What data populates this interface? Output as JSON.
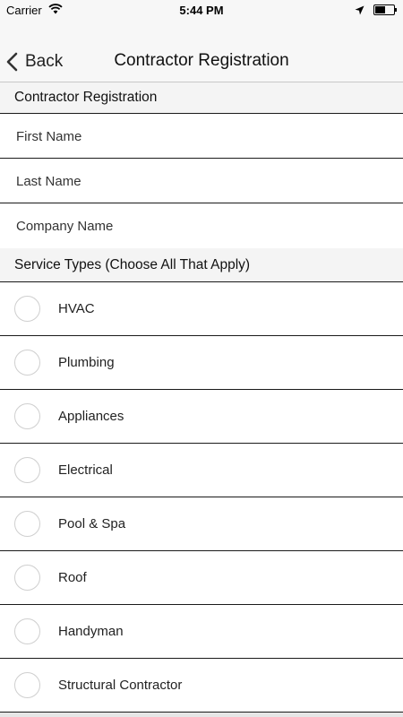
{
  "status_bar": {
    "carrier": "Carrier",
    "time": "5:44 PM",
    "icons": [
      "wifi-icon",
      "location-arrow-icon",
      "battery-icon"
    ]
  },
  "nav": {
    "back_label": "Back",
    "title": "Contractor Registration"
  },
  "form": {
    "section1_header": "Contractor Registration",
    "fields": [
      {
        "placeholder": "First Name",
        "value": ""
      },
      {
        "placeholder": "Last Name",
        "value": ""
      },
      {
        "placeholder": "Company Name",
        "value": ""
      }
    ],
    "section2_header": "Service Types (Choose All That Apply)",
    "service_types": [
      {
        "label": "HVAC",
        "selected": false
      },
      {
        "label": "Plumbing",
        "selected": false
      },
      {
        "label": "Appliances",
        "selected": false
      },
      {
        "label": "Electrical",
        "selected": false
      },
      {
        "label": "Pool & Spa",
        "selected": false
      },
      {
        "label": "Roof",
        "selected": false
      },
      {
        "label": "Handyman",
        "selected": false
      },
      {
        "label": "Structural Contractor",
        "selected": false
      }
    ]
  }
}
